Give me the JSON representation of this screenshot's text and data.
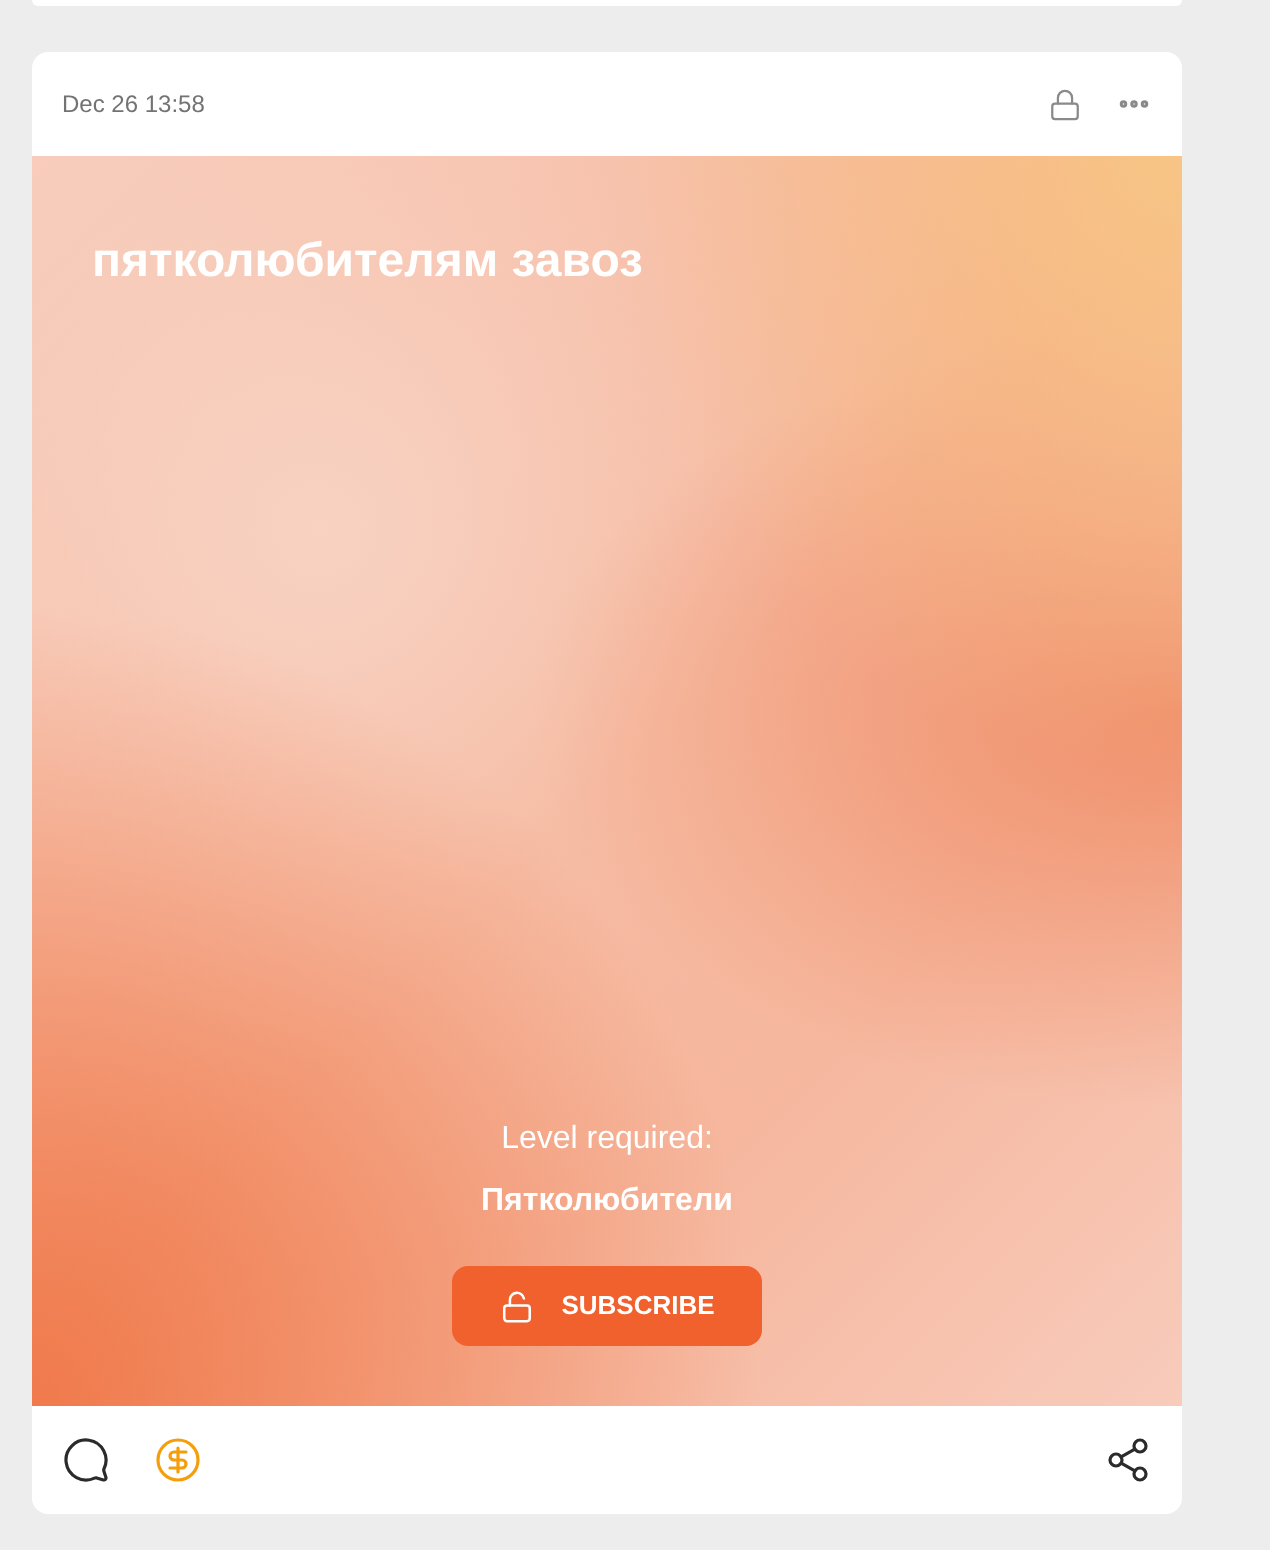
{
  "post": {
    "date": "Dec 26 13:58",
    "title": "пятколюбителям завоз",
    "level_label": "Level required:",
    "level_name": "Пятколюбители",
    "subscribe_button": "SUBSCRIBE"
  }
}
